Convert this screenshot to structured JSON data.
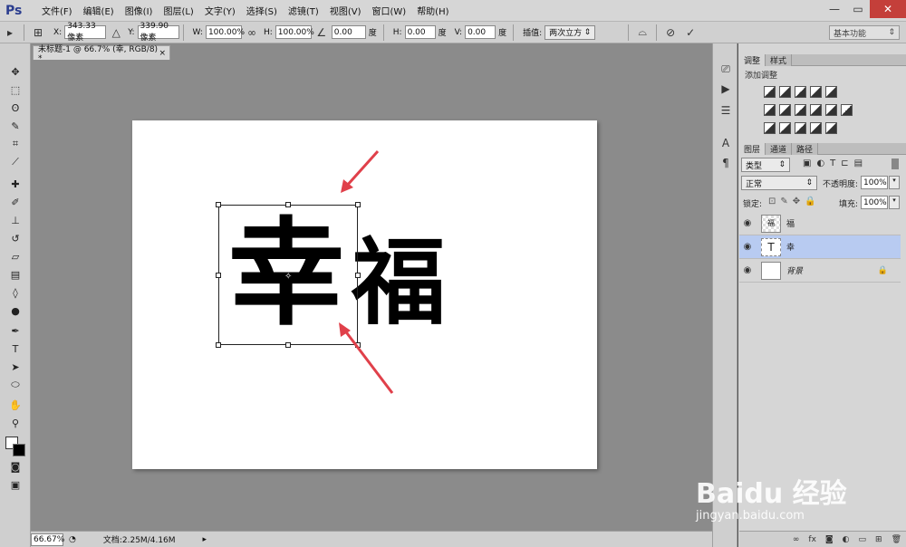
{
  "app": {
    "logo": "Ps"
  },
  "menu": [
    "文件(F)",
    "编辑(E)",
    "图像(I)",
    "图层(L)",
    "文字(Y)",
    "选择(S)",
    "滤镜(T)",
    "视图(V)",
    "窗口(W)",
    "帮助(H)"
  ],
  "window_controls": {
    "minimize": "—",
    "restore": "▭",
    "close": "✕"
  },
  "options": {
    "x_label": "X:",
    "x_value": "343.33 像素",
    "y_label": "Y:",
    "y_value": "339.90 像素",
    "w_label": "W:",
    "w_value": "100.00%",
    "h_label": "H:",
    "h_value": "100.00%",
    "angle_value": "0.00",
    "angle_unit": "度",
    "hskew_label": "H:",
    "hskew_value": "0.00",
    "hskew_unit": "度",
    "vskew_label": "V:",
    "vskew_value": "0.00",
    "vskew_unit": "度",
    "interp_label": "插值:",
    "interp_value": "两次立方",
    "workspace": "基本功能"
  },
  "document": {
    "tab_title": "未标题-1 @ 66.7% (幸, RGB/8) *"
  },
  "canvas_text": {
    "char1": "幸",
    "char2": "福"
  },
  "status": {
    "zoom": "66.67%",
    "doc_info": "文档:2.25M/4.16M"
  },
  "panels": {
    "adjust_tabs": [
      "调整",
      "样式"
    ],
    "adjust_title": "添加调整",
    "layer_tabs": [
      "图层",
      "通道",
      "路径"
    ],
    "filter_kind": "类型",
    "blend_mode": "正常",
    "opacity_label": "不透明度:",
    "opacity_value": "100%",
    "lock_label": "锁定:",
    "fill_label": "填充:",
    "fill_value": "100%"
  },
  "layers": [
    {
      "name": "福",
      "type": "smart"
    },
    {
      "name": "幸",
      "type": "text",
      "selected": true
    },
    {
      "name": "背景",
      "type": "background",
      "locked": true
    }
  ],
  "watermark": {
    "brand": "Baidu 经验",
    "url": "jingyan.baidu.com"
  },
  "colors": {
    "accent_arrow": "#e0404a",
    "selected_layer": "#b8cbf1",
    "close_button": "#c43f3a"
  }
}
